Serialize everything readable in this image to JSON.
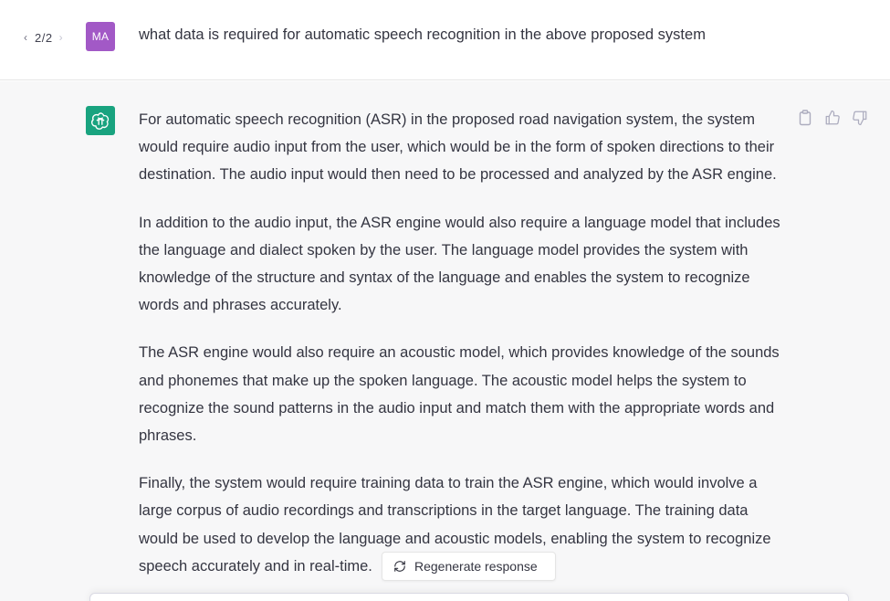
{
  "pager": {
    "prev_icon": "chevron-left-icon",
    "current": "2/2",
    "next_icon": "chevron-right-icon"
  },
  "user": {
    "initials": "MA",
    "avatar_color": "#a259c6",
    "message": "what data is required for automatic speech recognition in the above proposed system"
  },
  "assistant": {
    "avatar_icon": "openai-logo-icon",
    "avatar_color": "#19a37f",
    "paragraphs": [
      "For automatic speech recognition (ASR) in the proposed road navigation system, the system would require audio input from the user, which would be in the form of spoken directions to their destination. The audio input would then need to be processed and analyzed by the ASR engine.",
      "In addition to the audio input, the ASR engine would also require a language model that includes the language and dialect spoken by the user. The language model provides the system with knowledge of the structure and syntax of the language and enables the system to recognize words and phrases accurately.",
      "The ASR engine would also require an acoustic model, which provides knowledge of the sounds and phonemes that make up the spoken language. The acoustic model helps the system to recognize the sound patterns in the audio input and match them with the appropriate words and phrases.",
      "Finally, the system would require training data to train the ASR engine, which would involve a large corpus of audio recordings and transcriptions in the target language. The training data would be used to develop the language and acoustic models, enabling the system to recognize speech accurately and in real-time."
    ],
    "actions": [
      "copy-icon",
      "thumbs-up-icon",
      "thumbs-down-icon"
    ]
  },
  "regenerate": {
    "label": "Regenerate response",
    "icon": "refresh-icon"
  }
}
